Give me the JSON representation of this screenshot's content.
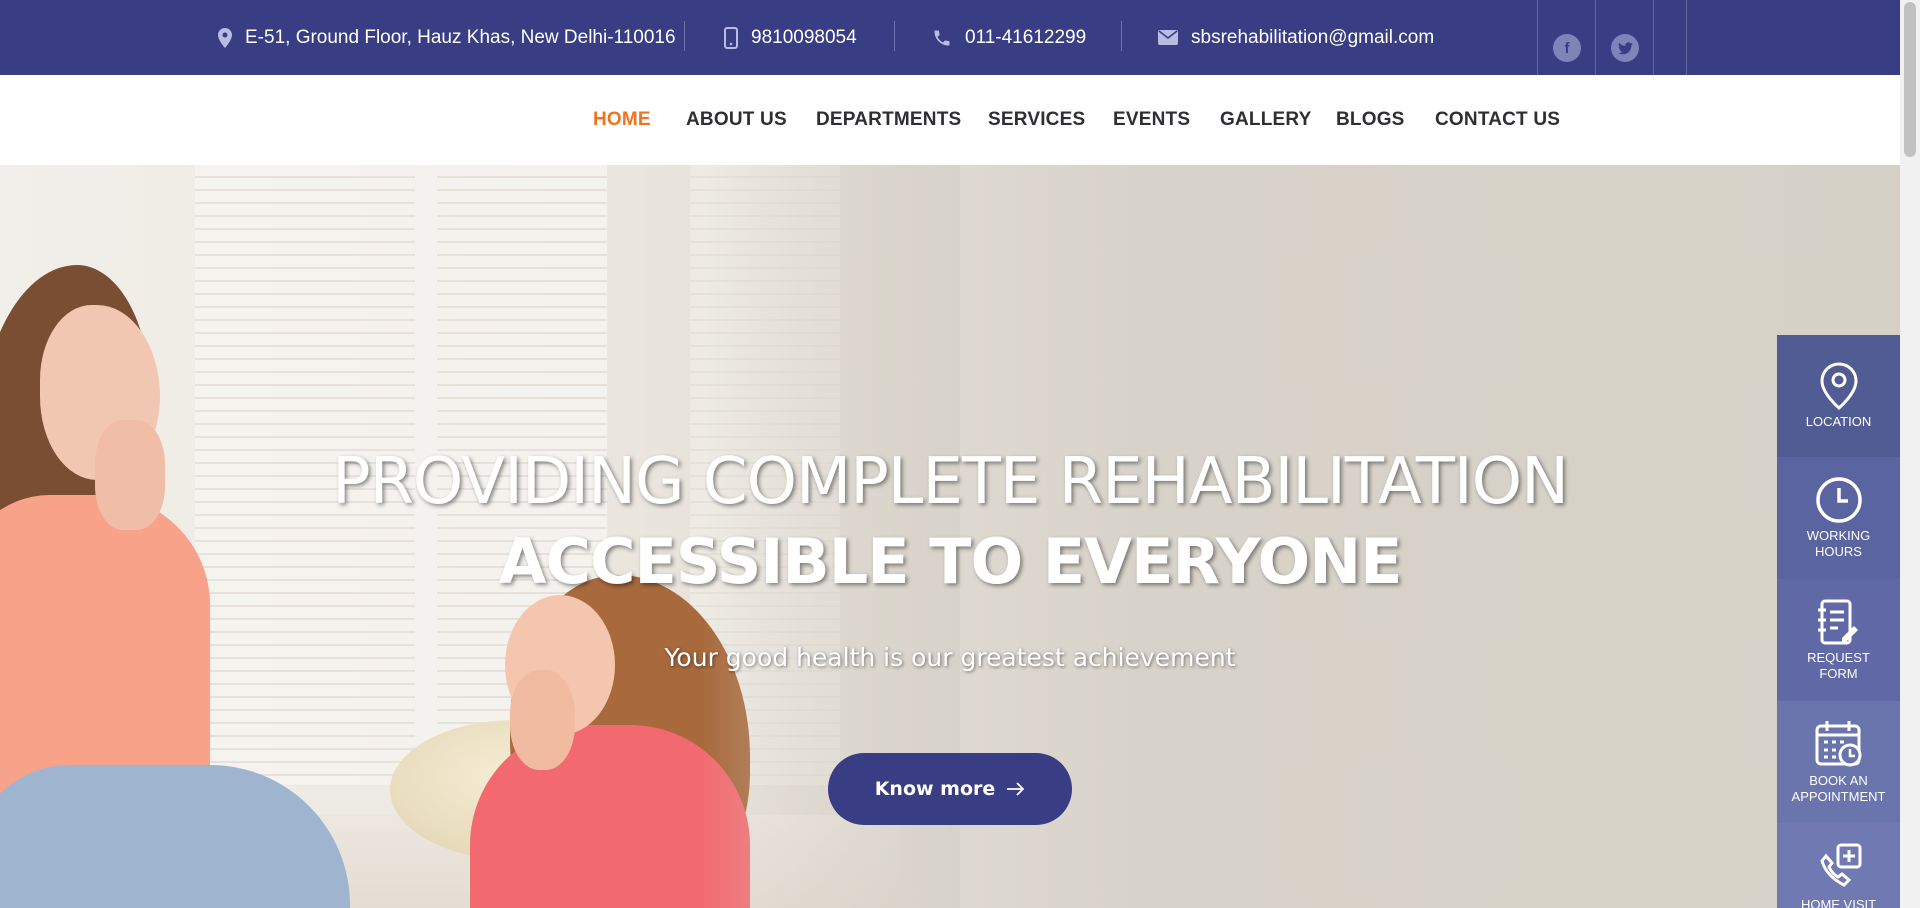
{
  "topbar": {
    "address": "E-51, Ground Floor, Hauz Khas, New Delhi-110016",
    "mobile": "9810098054",
    "phone": "011-41612299",
    "email": "sbsrehabilitation@gmail.com",
    "social": [
      {
        "icon": "facebook-icon",
        "glyph": "f"
      },
      {
        "icon": "twitter-icon",
        "glyph": "t"
      }
    ]
  },
  "nav": {
    "items": [
      {
        "label": "HOME",
        "active": true
      },
      {
        "label": "ABOUT US",
        "active": false
      },
      {
        "label": "DEPARTMENTS",
        "active": false
      },
      {
        "label": "SERVICES",
        "active": false
      },
      {
        "label": "EVENTS",
        "active": false
      },
      {
        "label": "GALLERY",
        "active": false
      },
      {
        "label": "BLOGS",
        "active": false
      },
      {
        "label": "CONTACT US",
        "active": false
      }
    ]
  },
  "hero": {
    "line1": "PROVIDING COMPLETE REHABILITATION",
    "line2": "ACCESSIBLE TO EVERYONE",
    "subtitle": "Your good health is our greatest achievement",
    "cta_label": "Know more"
  },
  "side_panel": {
    "items": [
      {
        "icon": "location-pin-icon",
        "label": "LOCATION"
      },
      {
        "icon": "clock-icon",
        "label": "WORKING\nHOURS"
      },
      {
        "icon": "form-icon",
        "label": "REQUEST\nFORM"
      },
      {
        "icon": "calendar-icon",
        "label": "BOOK AN\nAPPOINTMENT"
      },
      {
        "icon": "home-visit-phone-icon",
        "label": "HOME VISIT"
      }
    ]
  },
  "colors": {
    "brand": "#383d84",
    "accent": "#ef7321",
    "nav_text": "#2e2e35"
  }
}
